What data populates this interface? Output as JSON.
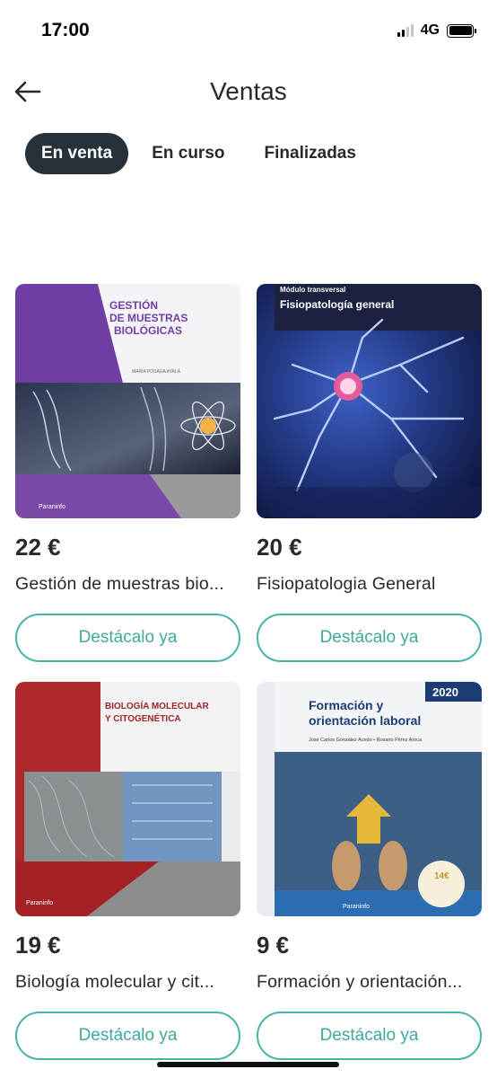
{
  "status_bar": {
    "time": "17:00",
    "network": "4G",
    "signal_bars": 2,
    "battery_level": 1.0
  },
  "header": {
    "title": "Ventas"
  },
  "tabs": [
    {
      "label": "En venta",
      "active": true
    },
    {
      "label": "En curso",
      "active": false
    },
    {
      "label": "Finalizadas",
      "active": false
    }
  ],
  "listings": [
    {
      "price": "22 €",
      "title": "Gestión de muestras bio...",
      "action": "Destácalo ya",
      "cover": {
        "line1": "GESTIÓN",
        "line2": "DE MUESTRAS",
        "line3": "BIOLÓGICAS",
        "author": "MARÍA POSADA AYALA",
        "publisher": "Paraninfo"
      }
    },
    {
      "price": "20 €",
      "title": "Fisiopatologia General",
      "action": "Destácalo ya",
      "cover": {
        "kicker": "Módulo transversal",
        "heading": "Fisiopatología general"
      }
    },
    {
      "price": "19 €",
      "title": "Biología molecular y cit...",
      "action": "Destácalo ya",
      "cover": {
        "line1": "BIOLOGÍA MOLECULAR",
        "line2": "Y CITOGENÉTICA",
        "publisher": "Paraninfo"
      }
    },
    {
      "price": "9 €",
      "title": "Formación y orientación...",
      "action": "Destácalo ya",
      "cover": {
        "badge": "2020",
        "line1": "Formación y",
        "line2": "orientación laboral",
        "authors": "José Carlos González Acedo • Rosario Pérez Aroca",
        "publisher": "Paraninfo",
        "sticker": "14€"
      }
    }
  ],
  "colors": {
    "accent": "#48b4a8",
    "active_tab": "#26313a",
    "text": "#26292e"
  },
  "icons": {
    "back": "arrow-left-icon"
  }
}
